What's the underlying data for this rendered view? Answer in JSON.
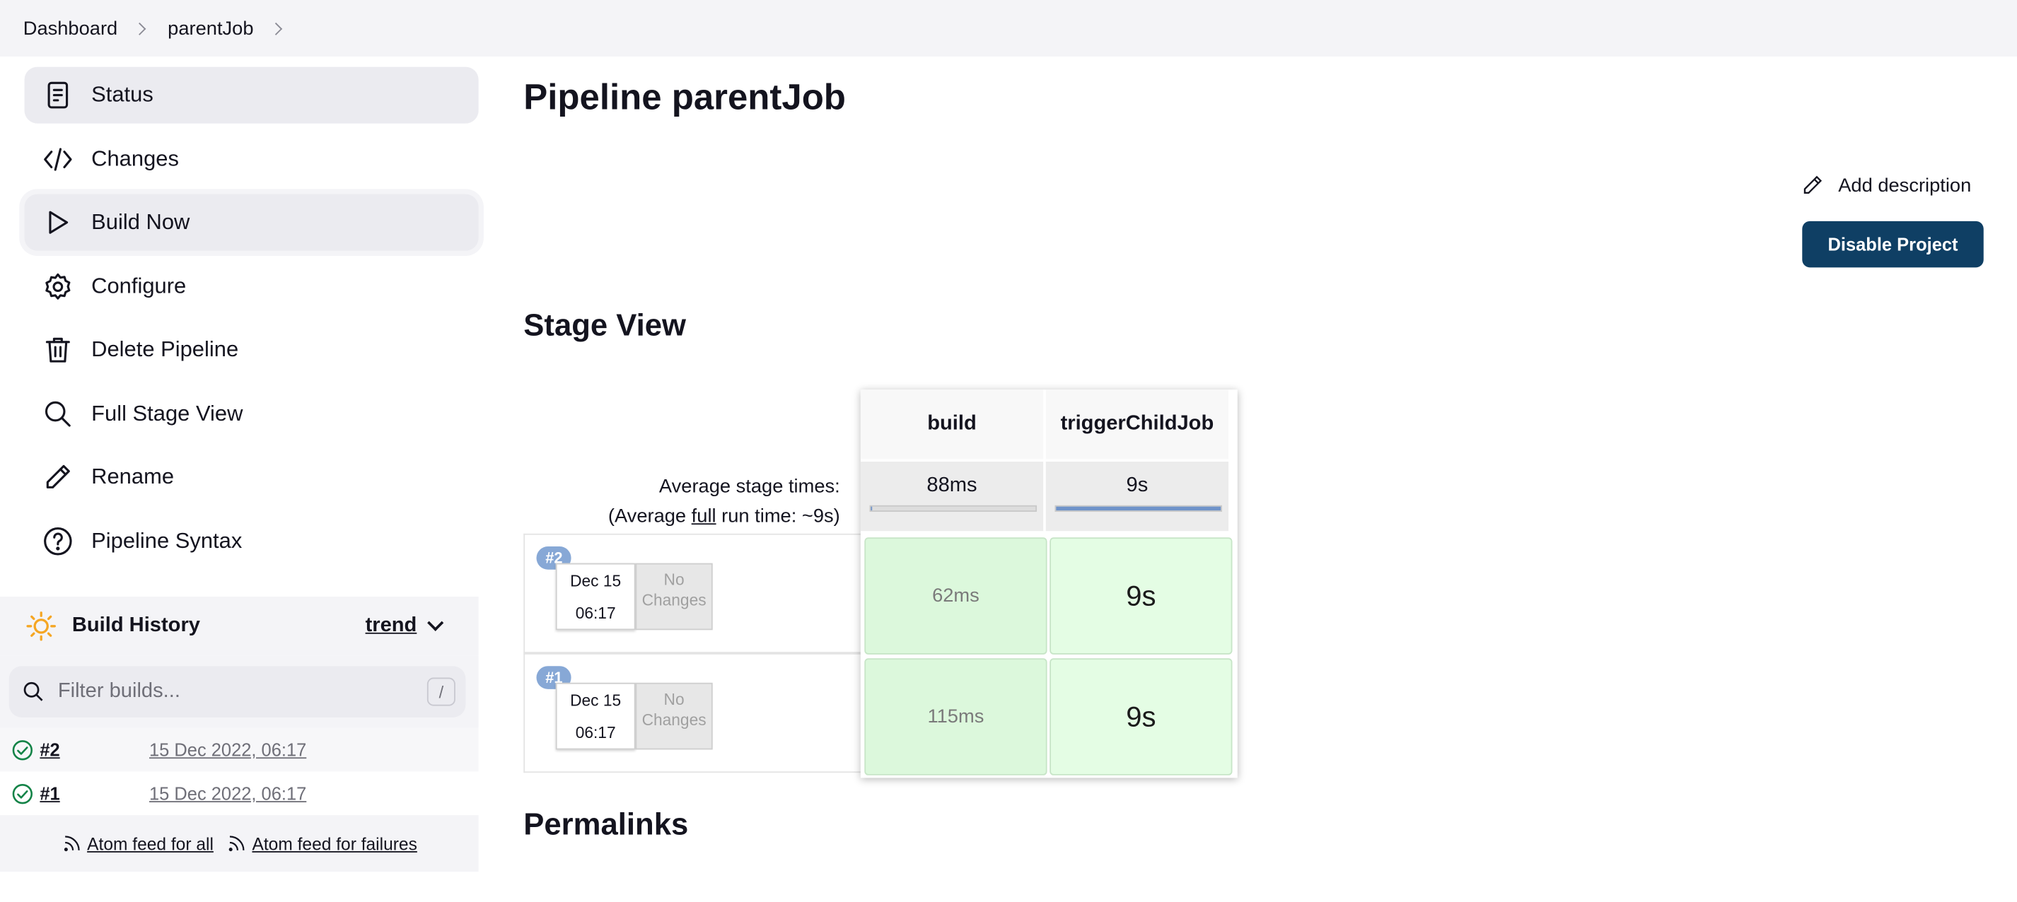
{
  "breadcrumb": {
    "items": [
      "Dashboard",
      "parentJob"
    ]
  },
  "sidebar": {
    "items": [
      {
        "label": "Status",
        "icon": "status-icon"
      },
      {
        "label": "Changes",
        "icon": "code-icon"
      },
      {
        "label": "Build Now",
        "icon": "play-icon"
      },
      {
        "label": "Configure",
        "icon": "gear-icon"
      },
      {
        "label": "Delete Pipeline",
        "icon": "trash-icon"
      },
      {
        "label": "Full Stage View",
        "icon": "search-icon"
      },
      {
        "label": "Rename",
        "icon": "pencil-icon"
      },
      {
        "label": "Pipeline Syntax",
        "icon": "help-icon"
      }
    ]
  },
  "build_history": {
    "title": "Build History",
    "trend_label": "trend",
    "filter_placeholder": "Filter builds...",
    "filter_shortcut": "/",
    "builds": [
      {
        "number": "#2",
        "date": "15 Dec 2022, 06:17",
        "status": "success"
      },
      {
        "number": "#1",
        "date": "15 Dec 2022, 06:17",
        "status": "success"
      }
    ],
    "feed_all": "Atom feed for all",
    "feed_failures": "Atom feed for failures"
  },
  "main": {
    "title": "Pipeline parentJob",
    "add_description": "Add description",
    "disable_button": "Disable Project",
    "stage_view_title": "Stage View",
    "permalinks_title": "Permalinks"
  },
  "stage_view": {
    "avg_label_line1": "Average stage times:",
    "avg_label_pre": "(Average ",
    "avg_label_full": "full",
    "avg_label_post": " run time: ~9s)",
    "stages": [
      {
        "name": "build",
        "avg": "88ms",
        "avg_fraction": 0.01
      },
      {
        "name": "triggerChildJob",
        "avg": "9s",
        "avg_fraction": 1.0
      }
    ],
    "runs": [
      {
        "badge": "#2",
        "date": "Dec 15",
        "time": "06:17",
        "changes_line1": "No",
        "changes_line2": "Changes",
        "times": [
          "62ms",
          "9s"
        ]
      },
      {
        "badge": "#1",
        "date": "Dec 15",
        "time": "06:17",
        "changes_line1": "No",
        "changes_line2": "Changes",
        "times": [
          "115ms",
          "9s"
        ]
      }
    ]
  },
  "colors": {
    "primary_button": "#0f3f64",
    "success": "#138347",
    "stage_success": "#dcf8dc",
    "progress_fill": "#6f93c9",
    "badge": "#87a8d6"
  }
}
